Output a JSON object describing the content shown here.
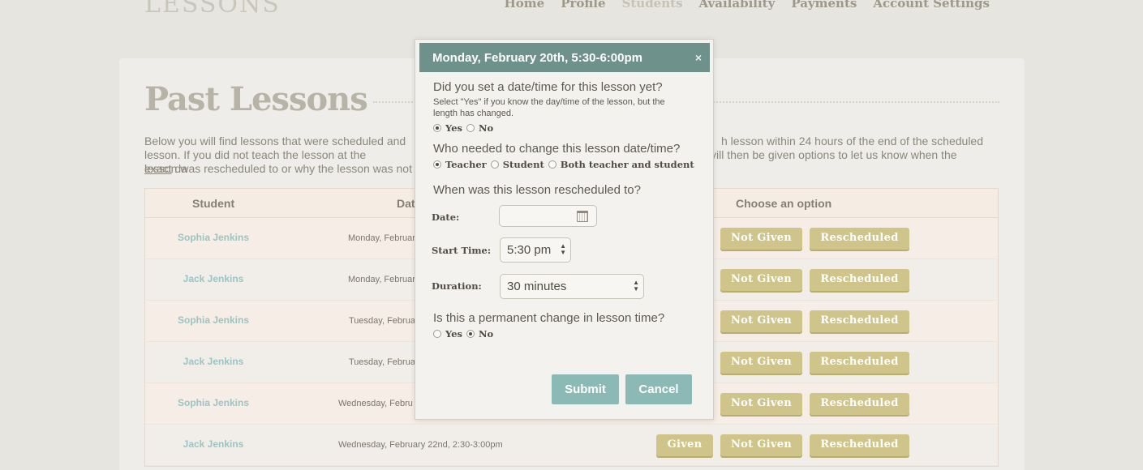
{
  "logo": "LESSONS",
  "nav": [
    "Home",
    "Profile",
    "Students",
    "Availability",
    "Payments",
    "Account Settings"
  ],
  "page": {
    "title": "Past Lessons",
    "intro": {
      "line1": "Below you will find lessons that were scheduled and",
      "line1b": "h lesson within 24 hours of the end of the scheduled",
      "line2a": "lesson. If you did not teach the lesson at the",
      "line2u": "exact",
      "line2b": "da",
      "line2c": "vill then be given options to let us know when the",
      "line3": "lesson was rescheduled to or why the lesson was not"
    }
  },
  "table": {
    "headers": {
      "student": "Student",
      "date": "Dat",
      "options": "Choose an option"
    },
    "rows": [
      {
        "student": "Sophia Jenkins",
        "date": "Monday, Februar"
      },
      {
        "student": "Jack Jenkins",
        "date": "Monday, Februar"
      },
      {
        "student": "Sophia Jenkins",
        "date": "Tuesday, Februa"
      },
      {
        "student": "Jack Jenkins",
        "date": "Tuesday, Februa"
      },
      {
        "student": "Sophia Jenkins",
        "date": "Wednesday, Febru"
      },
      {
        "student": "Jack Jenkins",
        "date": "Wednesday, February 22nd, 2:30-3:00pm"
      }
    ],
    "buttons": {
      "given": "Given",
      "not_given": "Not Given",
      "rescheduled": "Rescheduled"
    }
  },
  "modal": {
    "title": "Monday, February 20th, 5:30-6:00pm",
    "close": "×",
    "q1": "Did you set a date/time for this lesson yet?",
    "q1_hint_1": "Select \"Yes\" if you know the day/time of the lesson, but the",
    "q1_hint_2": "length has changed.",
    "q1_yes": "Yes",
    "q1_no": "No",
    "q2": "Who needed to change this lesson date/time?",
    "q2_teacher": "Teacher",
    "q2_student": "Student",
    "q2_both": "Both teacher and student",
    "q3": "When was this lesson rescheduled to?",
    "date_label": "Date:",
    "start_label": "Start Time:",
    "start_value": "5:30 pm",
    "duration_label": "Duration:",
    "duration_value": "30 minutes",
    "q4": "Is this a permanent change in lesson time?",
    "q4_yes": "Yes",
    "q4_no": "No",
    "submit": "Submit",
    "cancel": "Cancel"
  }
}
